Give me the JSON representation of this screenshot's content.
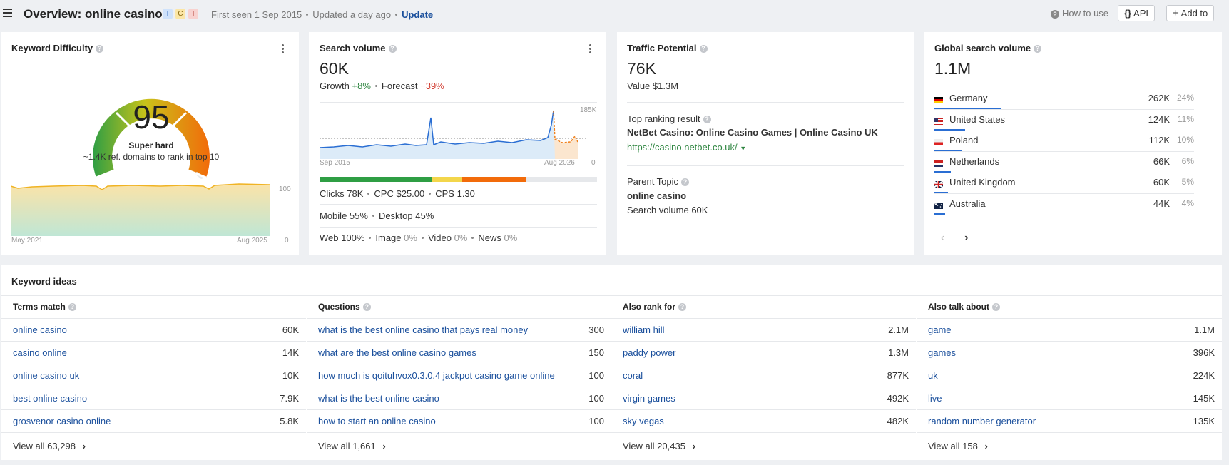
{
  "header": {
    "title": "Overview: online casino",
    "intents": [
      {
        "label": "I",
        "bg": "#cfe2fb",
        "fg": "#3a6fc4"
      },
      {
        "label": "C",
        "bg": "#fbe6a6",
        "fg": "#8a6a10"
      },
      {
        "label": "T",
        "bg": "#f8d2cf",
        "fg": "#b5483e"
      }
    ],
    "first_seen": "First seen 1 Sep 2015",
    "updated": "Updated a day ago",
    "update_link": "Update",
    "how_to_use": "How to use",
    "api_label": "API",
    "add_to_label": "Add to"
  },
  "difficulty": {
    "title": "Keyword Difficulty",
    "score": "95",
    "level": "Super hard",
    "note": "~1.4K ref. domains to rank in top 10",
    "axis_start": "May 2021",
    "axis_end": "Aug 2025",
    "y_top": "100",
    "y_bottom": "0"
  },
  "search_volume": {
    "title": "Search volume",
    "value": "60K",
    "growth_label": "Growth",
    "growth_value": "+8%",
    "forecast_label": "Forecast",
    "forecast_value": "−39%",
    "y_top": "185K",
    "y_bottom": "0",
    "axis_start": "Sep 2015",
    "axis_end": "Aug 2026",
    "clicks": "Clicks 78K",
    "cpc": "CPC $25.00",
    "cps": "CPS 1.30",
    "mobile": "Mobile 55%",
    "desktop": "Desktop 45%",
    "serp_types": [
      {
        "label": "Web",
        "pct": "100%"
      },
      {
        "label": "Image",
        "pct": "0%"
      },
      {
        "label": "Video",
        "pct": "0%"
      },
      {
        "label": "News",
        "pct": "0%"
      }
    ]
  },
  "traffic": {
    "title": "Traffic Potential",
    "value": "76K",
    "value_label": "Value $1.3M",
    "top_ranking_label": "Top ranking result",
    "top_ranking_title": "NetBet Casino: Online Casino Games | Online Casino UK",
    "top_ranking_url": "https://casino.netbet.co.uk/",
    "parent_topic_label": "Parent Topic",
    "parent_topic": "online casino",
    "parent_volume": "Search volume 60K"
  },
  "global": {
    "title": "Global search volume",
    "value": "1.1M",
    "countries": [
      {
        "name": "Germany",
        "value": "262K",
        "pct": "24%",
        "share": 0.24
      },
      {
        "name": "United States",
        "value": "124K",
        "pct": "11%",
        "share": 0.11
      },
      {
        "name": "Poland",
        "value": "112K",
        "pct": "10%",
        "share": 0.1
      },
      {
        "name": "Netherlands",
        "value": "66K",
        "pct": "6%",
        "share": 0.06
      },
      {
        "name": "United Kingdom",
        "value": "60K",
        "pct": "5%",
        "share": 0.05
      },
      {
        "name": "Australia",
        "value": "44K",
        "pct": "4%",
        "share": 0.04
      }
    ]
  },
  "ideas": {
    "title": "Keyword ideas",
    "columns": [
      {
        "header": "Terms match",
        "view_all": "View all 63,298",
        "rows": [
          {
            "kw": "online casino",
            "v": "60K"
          },
          {
            "kw": "casino online",
            "v": "14K"
          },
          {
            "kw": "online casino uk",
            "v": "10K"
          },
          {
            "kw": "best online casino",
            "v": "7.9K"
          },
          {
            "kw": "grosvenor casino online",
            "v": "5.8K"
          }
        ]
      },
      {
        "header": "Questions",
        "view_all": "View all 1,661",
        "rows": [
          {
            "kw": "what is the best online casino that pays real money",
            "v": "300"
          },
          {
            "kw": "what are the best online casino games",
            "v": "150"
          },
          {
            "kw": "how much is qoituhvox0.3.0.4 jackpot casino game online",
            "v": "100"
          },
          {
            "kw": "what is the best online casino",
            "v": "100"
          },
          {
            "kw": "how to start an online casino",
            "v": "100"
          }
        ]
      },
      {
        "header": "Also rank for",
        "view_all": "View all 20,435",
        "rows": [
          {
            "kw": "william hill",
            "v": "2.1M"
          },
          {
            "kw": "paddy power",
            "v": "1.3M"
          },
          {
            "kw": "coral",
            "v": "877K"
          },
          {
            "kw": "virgin games",
            "v": "492K"
          },
          {
            "kw": "sky vegas",
            "v": "482K"
          }
        ]
      },
      {
        "header": "Also talk about",
        "view_all": "View all 158",
        "rows": [
          {
            "kw": "game",
            "v": "1.1M"
          },
          {
            "kw": "games",
            "v": "396K"
          },
          {
            "kw": "uk",
            "v": "224K"
          },
          {
            "kw": "live",
            "v": "145K"
          },
          {
            "kw": "random number generator",
            "v": "135K"
          }
        ]
      }
    ]
  }
}
